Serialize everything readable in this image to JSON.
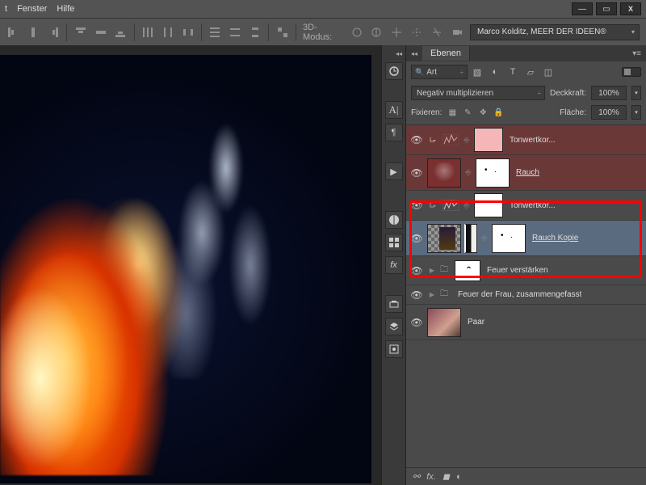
{
  "menu": {
    "item1": "t",
    "item2": "Fenster",
    "item3": "Hilfe"
  },
  "window_controls": {
    "min": "—",
    "max": "▭",
    "close": "X"
  },
  "toolbar": {
    "mode_label": "3D-Modus:",
    "user_dropdown": "Marco Kolditz, MEER DER IDEEN®"
  },
  "panel": {
    "tab": "Ebenen",
    "filter_kind": "Art",
    "blend_mode": "Negativ multiplizieren",
    "opacity_label": "Deckkraft:",
    "opacity_value": "100%",
    "lock_label": "Fixieren:",
    "fill_label": "Fläche:",
    "fill_value": "100%"
  },
  "layers": {
    "l1": "Tonwertkor...",
    "l2": "Rauch",
    "l3": "Tonwertkor...",
    "l4": "Rauch Kopie",
    "l5": "Feuer verstärken",
    "l6": "Feuer der Frau, zusammengefasst",
    "l7": "Paar"
  },
  "bottom_icons": {
    "fx": "fx."
  }
}
